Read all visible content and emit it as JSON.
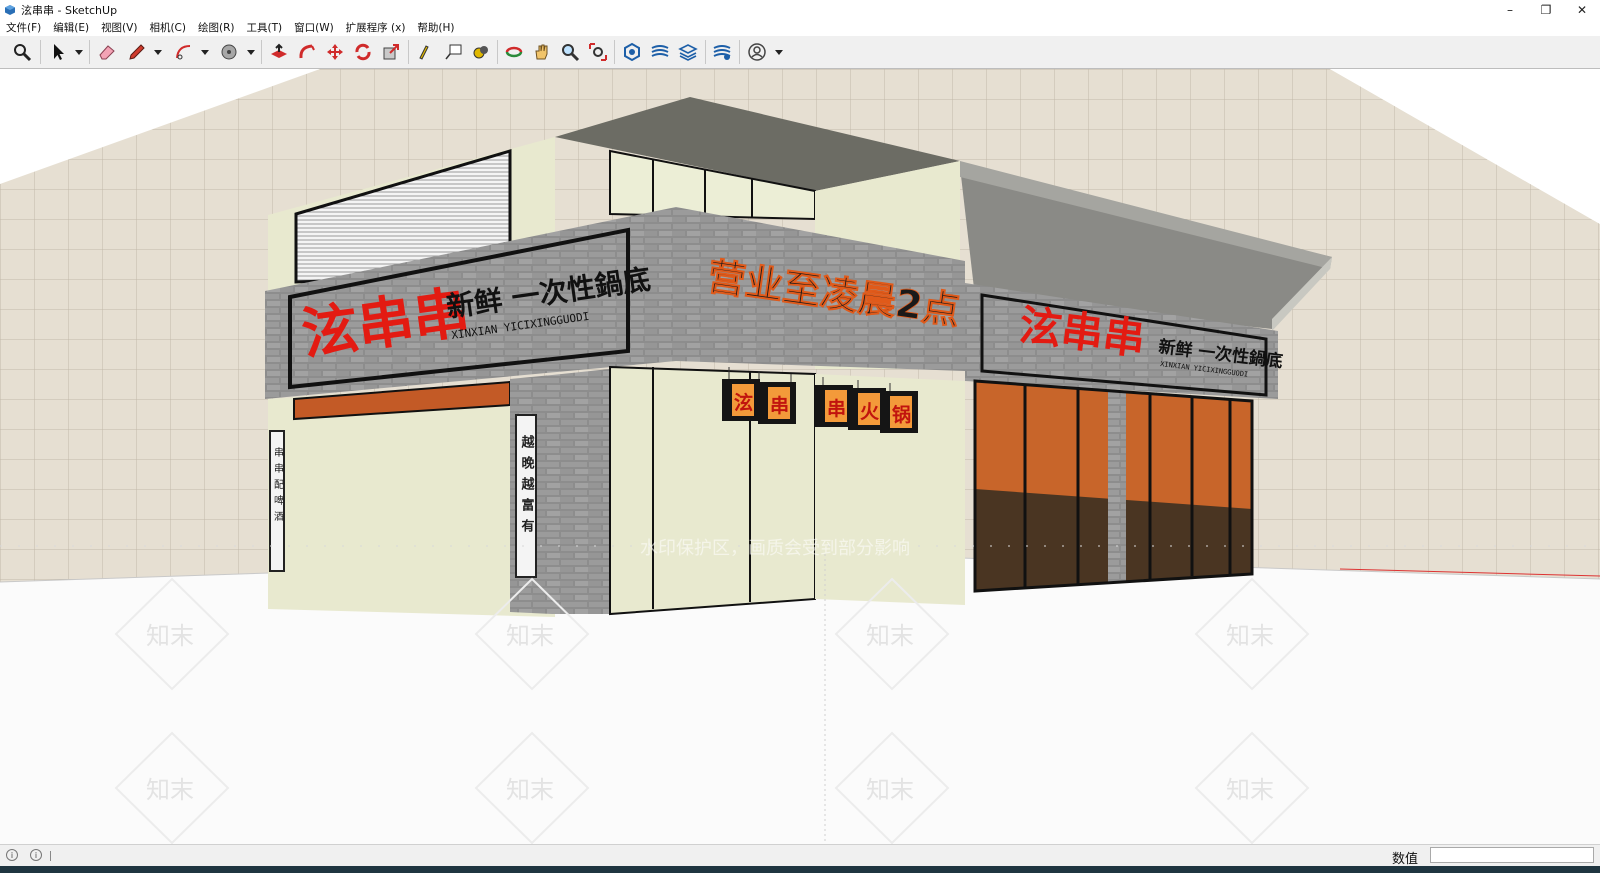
{
  "window": {
    "title": "泫串串 - SketchUp",
    "app_icon": "sketchup-logo-icon",
    "controls": [
      "minimize-icon",
      "restore-icon",
      "close-icon"
    ]
  },
  "menu": {
    "items": [
      "文件(F)",
      "编辑(E)",
      "视图(V)",
      "相机(C)",
      "绘图(R)",
      "工具(T)",
      "窗口(W)",
      "扩展程序 (x)",
      "帮助(H)"
    ]
  },
  "toolbar": {
    "tools": [
      "zoom-extents-icon",
      "select-icon",
      "eraser-icon",
      "pencil-line-icon",
      "arc-icon",
      "tape-measure-icon",
      "push-pull-icon",
      "follow-me-icon",
      "move-icon",
      "rotate-icon",
      "scale-icon",
      "paint-bucket-icon",
      "text-icon",
      "dimension-icon",
      "orbit-icon",
      "pan-icon",
      "zoom-icon",
      "zoom-window-icon",
      "warehouse-icon",
      "extension-warehouse-icon",
      "layout-icon",
      "extension-manager-icon",
      "account-icon"
    ]
  },
  "scene": {
    "sign_left_brand": "泫串串",
    "sign_left_slogan": "新鲜 一次性鍋底",
    "sign_left_pinyin": "XINXIAN YICIXINGGUODI",
    "sign_center": "营业至凌晨2点",
    "sign_right_brand": "泫串串",
    "sign_right_slogan": "新鲜 一次性鍋底",
    "sign_right_pinyin": "XINXIAN YICIXINGGUODI",
    "lanterns": [
      "泫",
      "串",
      "串",
      "火",
      "锅"
    ],
    "scroll_left": "串串配啤酒",
    "scroll_right": "越晚越富有",
    "watermark_band": "水印保护区，画质会受到部分影响",
    "watermark_logo": "知末",
    "colors": {
      "brand_red": "#e31b12",
      "brick": "#8f8f8f",
      "wall": "#e8e9cf",
      "lantern": "#f39a3a",
      "interior": "#d26a2c"
    }
  },
  "status": {
    "measurement_label": "数值",
    "measurement_value": ""
  }
}
